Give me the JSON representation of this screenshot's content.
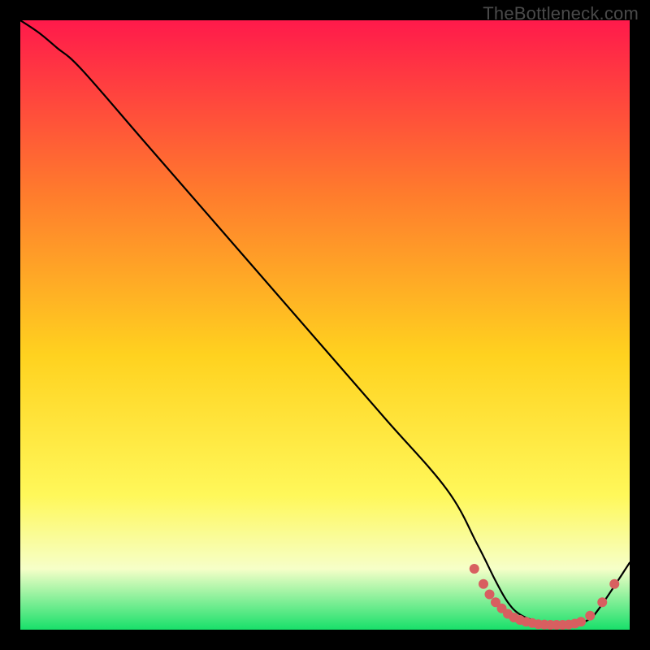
{
  "watermark": "TheBottleneck.com",
  "colors": {
    "top": "#ff1a4b",
    "mid_upper": "#ff7a2d",
    "mid": "#ffd21f",
    "mid_lower": "#fff85a",
    "pale": "#f6ffc8",
    "green": "#18e06a",
    "curve": "#000000",
    "dot": "#d85f60",
    "background": "#000000"
  },
  "chart_data": {
    "type": "line",
    "title": "",
    "xlabel": "",
    "ylabel": "",
    "xlim": [
      0,
      100
    ],
    "ylim": [
      0,
      100
    ],
    "series": [
      {
        "name": "bottleneck-curve",
        "x": [
          0,
          3,
          6,
          10,
          20,
          30,
          40,
          50,
          60,
          70,
          75,
          78,
          80,
          82,
          85,
          88,
          90,
          93,
          95,
          100
        ],
        "y": [
          100,
          98,
          95.5,
          92,
          80.5,
          69,
          57.5,
          46,
          34.5,
          23,
          14,
          8,
          4.5,
          2.5,
          1.3,
          0.8,
          0.8,
          1.5,
          3.5,
          11
        ]
      }
    ],
    "dots": {
      "name": "highlight-dots",
      "points": [
        {
          "x": 74.5,
          "y": 10.0
        },
        {
          "x": 76.0,
          "y": 7.5
        },
        {
          "x": 77.0,
          "y": 5.8
        },
        {
          "x": 78.0,
          "y": 4.5
        },
        {
          "x": 79.0,
          "y": 3.5
        },
        {
          "x": 80.0,
          "y": 2.6
        },
        {
          "x": 81.0,
          "y": 2.0
        },
        {
          "x": 82.0,
          "y": 1.6
        },
        {
          "x": 83.0,
          "y": 1.3
        },
        {
          "x": 84.0,
          "y": 1.1
        },
        {
          "x": 85.0,
          "y": 0.9
        },
        {
          "x": 86.0,
          "y": 0.85
        },
        {
          "x": 87.0,
          "y": 0.8
        },
        {
          "x": 88.0,
          "y": 0.8
        },
        {
          "x": 89.0,
          "y": 0.8
        },
        {
          "x": 90.0,
          "y": 0.85
        },
        {
          "x": 91.0,
          "y": 1.0
        },
        {
          "x": 92.0,
          "y": 1.3
        },
        {
          "x": 93.5,
          "y": 2.3
        },
        {
          "x": 95.5,
          "y": 4.5
        },
        {
          "x": 97.5,
          "y": 7.5
        }
      ]
    }
  }
}
